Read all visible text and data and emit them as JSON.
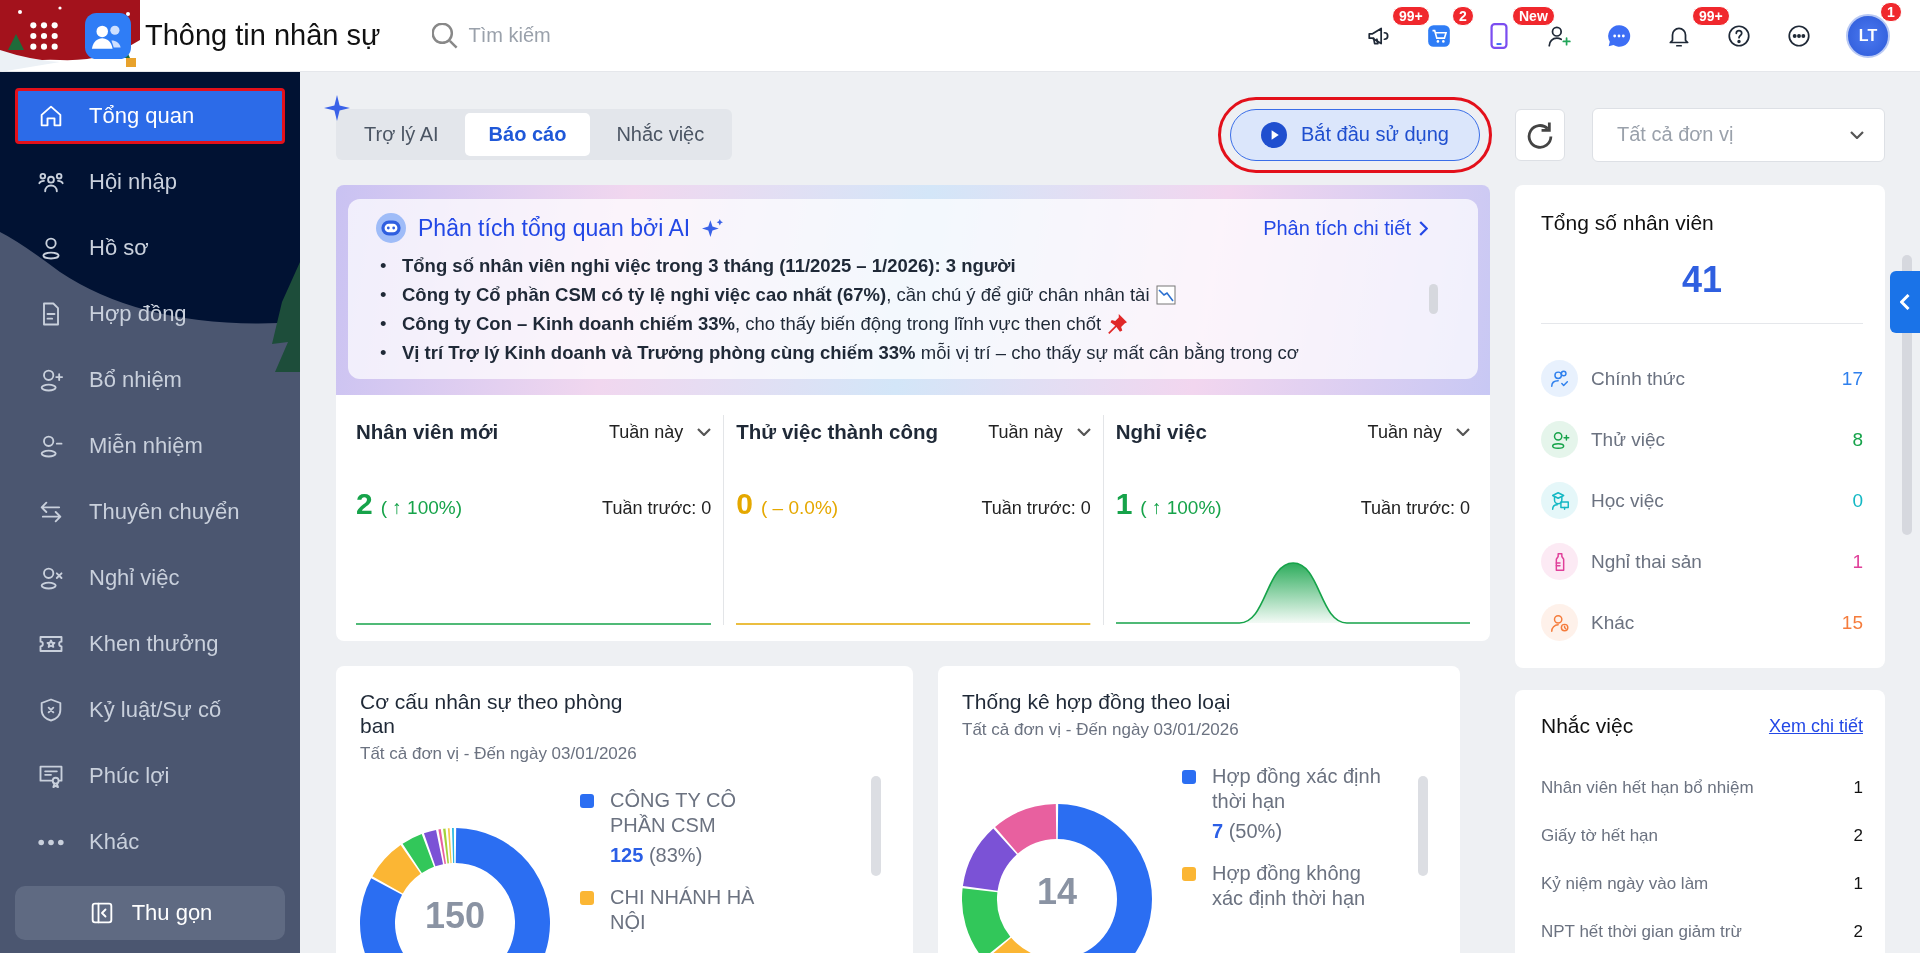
{
  "header": {
    "title": "Thông tin nhân sự",
    "search": {
      "placeholder": "Tìm kiếm"
    },
    "actions": [
      {
        "kind": "megaphone",
        "badge": "99+"
      },
      {
        "kind": "cart",
        "badge": "2"
      },
      {
        "kind": "phone",
        "badge": "New"
      },
      {
        "kind": "user-add"
      },
      {
        "kind": "chat"
      },
      {
        "kind": "bell",
        "badge": "99+"
      },
      {
        "kind": "help"
      },
      {
        "kind": "more"
      }
    ],
    "avatar": {
      "initials": "LT",
      "badge": "1"
    }
  },
  "sidebar": {
    "items": [
      {
        "label": "Tổng quan",
        "selected": true
      },
      {
        "label": "Hội nhập",
        "selected": false
      },
      {
        "label": "Hồ sơ",
        "selected": false
      },
      {
        "label": "Hợp đồng",
        "selected": false
      },
      {
        "label": "Bổ nhiệm",
        "selected": false
      },
      {
        "label": "Miễn nhiệm",
        "selected": false
      },
      {
        "label": "Thuyên chuyển",
        "selected": false
      },
      {
        "label": "Nghỉ việc",
        "selected": false
      },
      {
        "label": "Khen thưởng",
        "selected": false
      },
      {
        "label": "Kỷ luật/Sự cố",
        "selected": false
      },
      {
        "label": "Phúc lợi",
        "selected": false
      },
      {
        "label": "Khác",
        "selected": false
      }
    ],
    "collapse": "Thu gọn"
  },
  "toolbar": {
    "tabs": [
      {
        "label": "Trợ lý AI",
        "selected": false
      },
      {
        "label": "Báo cáo",
        "selected": true
      },
      {
        "label": "Nhắc việc",
        "selected": false
      }
    ],
    "start_button": "Bắt đầu sử dụng",
    "unit_select": {
      "value": "Tất cả đơn vị"
    }
  },
  "ai_summary": {
    "title": "Phân tích tổng quan bởi AI",
    "detail_link": "Phân tích chi tiết",
    "bullets": [
      {
        "marker": "•",
        "text": "Tổng số nhân viên nghỉ việc trong 3 tháng (11/2025 – 1/2026): 3 người",
        "bold": true
      },
      {
        "marker": "•",
        "text": "**Công ty Cổ phần CSM có tỷ lệ nghỉ việc cao nhất (67%)**, cần chú ý để giữ chân nhân tài",
        "bold": false
      },
      {
        "marker": "•",
        "text": "**Công ty Con – Kinh doanh chiếm 33%**, cho thấy biến động trong lĩnh vực then chốt",
        "bold": false
      },
      {
        "marker": "•",
        "text": "**Vị trí Trợ lý Kinh doanh và Trưởng phòng cùng chiếm 33%** mỗi vị trí – cho thấy sự mất cân bằng trong cơ",
        "bold": false
      }
    ]
  },
  "stats": [
    {
      "title": "Nhân viên mới",
      "period": "Tuần này",
      "value": "2",
      "change": "( ↑ 100%)",
      "previous": "Tuần trước: 0",
      "color": "#16a34a"
    },
    {
      "title": "Thử việc thành công",
      "period": "Tuần này",
      "value": "0",
      "change": "( – 0.0%)",
      "previous": "Tuần trước: 0",
      "color": "#e5a800"
    },
    {
      "title": "Nghỉ việc",
      "period": "Tuần này",
      "value": "1",
      "change": "( ↑ 100%)",
      "previous": "Tuần trước: 0",
      "color": "#16a34a"
    }
  ],
  "charts": [
    {
      "title": "Cơ cấu nhân sự theo phòng ban",
      "subtitle": "Tất cả đơn vị - Đến ngày 03/01/2026",
      "total": "150",
      "legend": [
        {
          "label": "CÔNG TY CÔ PHẦN CSM",
          "value": "125",
          "share": "(83%)",
          "color": "#2b6ef2"
        },
        {
          "label": "CHI NHÁNH HÀ NỘI",
          "color": "#fbb634"
        }
      ]
    },
    {
      "title": "Thống kê hợp đồng theo loại",
      "subtitle": "Tất cả đơn vị - Đến ngày 03/01/2026",
      "total": "14",
      "legend": [
        {
          "label": "Hợp đồng xác định thời hạn",
          "value": "7",
          "share": "(50%)",
          "color": "#2b6ef2"
        },
        {
          "label": "Hợp đồng không xác định thời hạn",
          "color": "#fbb634"
        }
      ]
    }
  ],
  "employees": {
    "title": "Tổng số nhân viên",
    "total": "41",
    "categories": [
      {
        "label": "Chính thức",
        "value": "17",
        "color": "#2f80ed"
      },
      {
        "label": "Thử việc",
        "value": "8",
        "color": "#16a34a"
      },
      {
        "label": "Học việc",
        "value": "0",
        "color": "#14b8c4"
      },
      {
        "label": "Nghỉ thai sản",
        "value": "1",
        "color": "#e0409a"
      },
      {
        "label": "Khác",
        "value": "15",
        "color": "#f57c3c"
      }
    ]
  },
  "reminders": {
    "title": "Nhắc việc",
    "link": "Xem chi tiết",
    "items": [
      {
        "label": "Nhân viên hết hạn bổ nhiệm",
        "count": "1"
      },
      {
        "label": "Giấy tờ hết hạn",
        "count": "2"
      },
      {
        "label": "Kỷ niệm ngày vào làm",
        "count": "1"
      },
      {
        "label": "NPT hết thời gian giảm trừ",
        "count": "2"
      }
    ]
  }
}
